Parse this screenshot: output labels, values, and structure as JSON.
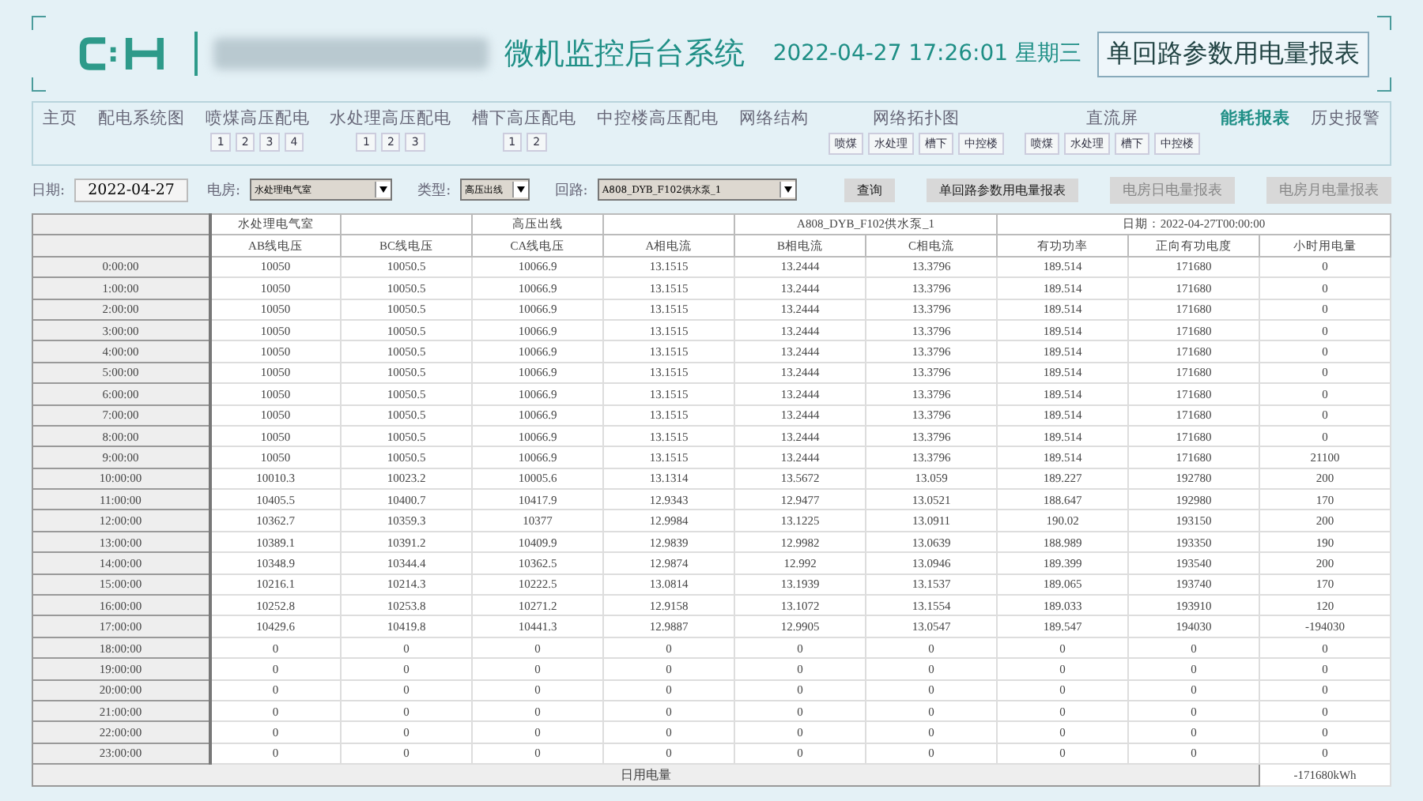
{
  "header": {
    "system_title": "微机监控后台系统",
    "datetime": "2022-04-27 17:26:01 星期三",
    "report_title": "单回路参数用电量报表"
  },
  "nav": [
    {
      "label": "主页",
      "selected": false
    },
    {
      "label": "配电系统图",
      "selected": false
    },
    {
      "label": "喷煤高压配电",
      "selected": false,
      "subs": [
        "1",
        "2",
        "3",
        "4"
      ]
    },
    {
      "label": "水处理高压配电",
      "selected": false,
      "subs": [
        "1",
        "2",
        "3"
      ]
    },
    {
      "label": "槽下高压配电",
      "selected": false,
      "subs": [
        "1",
        "2"
      ]
    },
    {
      "label": "中控楼高压配电",
      "selected": false
    },
    {
      "label": "网络结构",
      "selected": false
    },
    {
      "label": "网络拓扑图",
      "selected": false,
      "subs": [
        "喷煤",
        "水处理",
        "槽下",
        "中控楼"
      ]
    },
    {
      "label": "直流屏",
      "selected": false,
      "subs": [
        "喷煤",
        "水处理",
        "槽下",
        "中控楼"
      ]
    },
    {
      "label": "能耗报表",
      "selected": true
    },
    {
      "label": "历史报警",
      "selected": false
    }
  ],
  "toolbar": {
    "date_label": "日期:",
    "date": "2022-04-27",
    "room_label": "电房:",
    "room": "水处理电气室",
    "type_label": "类型:",
    "type": "高压出线",
    "circuit_label": "回路:",
    "circuit": "A808_DYB_F102供水泵_1",
    "buttons": [
      {
        "label": "查询",
        "disabled": false
      },
      {
        "label": "单回路参数用电量报表",
        "disabled": false
      },
      {
        "label": "电房日电量报表",
        "disabled": true
      },
      {
        "label": "电房月电量报表",
        "disabled": true
      }
    ]
  },
  "table": {
    "group_headers": {
      "room": "水处理电气室",
      "type": "高压出线",
      "circuit": "A808_DYB_F102供水泵_1",
      "date": "日期：2022-04-27T00:00:00"
    },
    "columns": [
      "",
      "AB线电压",
      "BC线电压",
      "CA线电压",
      "A相电流",
      "B相电流",
      "C相电流",
      "有功功率",
      "正向有功电度",
      "小时用电量"
    ],
    "rows": [
      [
        "0:00:00",
        "10050",
        "10050.5",
        "10066.9",
        "13.1515",
        "13.2444",
        "13.3796",
        "189.514",
        "171680",
        "0"
      ],
      [
        "1:00:00",
        "10050",
        "10050.5",
        "10066.9",
        "13.1515",
        "13.2444",
        "13.3796",
        "189.514",
        "171680",
        "0"
      ],
      [
        "2:00:00",
        "10050",
        "10050.5",
        "10066.9",
        "13.1515",
        "13.2444",
        "13.3796",
        "189.514",
        "171680",
        "0"
      ],
      [
        "3:00:00",
        "10050",
        "10050.5",
        "10066.9",
        "13.1515",
        "13.2444",
        "13.3796",
        "189.514",
        "171680",
        "0"
      ],
      [
        "4:00:00",
        "10050",
        "10050.5",
        "10066.9",
        "13.1515",
        "13.2444",
        "13.3796",
        "189.514",
        "171680",
        "0"
      ],
      [
        "5:00:00",
        "10050",
        "10050.5",
        "10066.9",
        "13.1515",
        "13.2444",
        "13.3796",
        "189.514",
        "171680",
        "0"
      ],
      [
        "6:00:00",
        "10050",
        "10050.5",
        "10066.9",
        "13.1515",
        "13.2444",
        "13.3796",
        "189.514",
        "171680",
        "0"
      ],
      [
        "7:00:00",
        "10050",
        "10050.5",
        "10066.9",
        "13.1515",
        "13.2444",
        "13.3796",
        "189.514",
        "171680",
        "0"
      ],
      [
        "8:00:00",
        "10050",
        "10050.5",
        "10066.9",
        "13.1515",
        "13.2444",
        "13.3796",
        "189.514",
        "171680",
        "0"
      ],
      [
        "9:00:00",
        "10050",
        "10050.5",
        "10066.9",
        "13.1515",
        "13.2444",
        "13.3796",
        "189.514",
        "171680",
        "21100"
      ],
      [
        "10:00:00",
        "10010.3",
        "10023.2",
        "10005.6",
        "13.1314",
        "13.5672",
        "13.059",
        "189.227",
        "192780",
        "200"
      ],
      [
        "11:00:00",
        "10405.5",
        "10400.7",
        "10417.9",
        "12.9343",
        "12.9477",
        "13.0521",
        "188.647",
        "192980",
        "170"
      ],
      [
        "12:00:00",
        "10362.7",
        "10359.3",
        "10377",
        "12.9984",
        "13.1225",
        "13.0911",
        "190.02",
        "193150",
        "200"
      ],
      [
        "13:00:00",
        "10389.1",
        "10391.2",
        "10409.9",
        "12.9839",
        "12.9982",
        "13.0639",
        "188.989",
        "193350",
        "190"
      ],
      [
        "14:00:00",
        "10348.9",
        "10344.4",
        "10362.5",
        "12.9874",
        "12.992",
        "13.0946",
        "189.399",
        "193540",
        "200"
      ],
      [
        "15:00:00",
        "10216.1",
        "10214.3",
        "10222.5",
        "13.0814",
        "13.1939",
        "13.1537",
        "189.065",
        "193740",
        "170"
      ],
      [
        "16:00:00",
        "10252.8",
        "10253.8",
        "10271.2",
        "12.9158",
        "13.1072",
        "13.1554",
        "189.033",
        "193910",
        "120"
      ],
      [
        "17:00:00",
        "10429.6",
        "10419.8",
        "10441.3",
        "12.9887",
        "12.9905",
        "13.0547",
        "189.547",
        "194030",
        "-194030"
      ],
      [
        "18:00:00",
        "0",
        "0",
        "0",
        "0",
        "0",
        "0",
        "0",
        "0",
        "0"
      ],
      [
        "19:00:00",
        "0",
        "0",
        "0",
        "0",
        "0",
        "0",
        "0",
        "0",
        "0"
      ],
      [
        "20:00:00",
        "0",
        "0",
        "0",
        "0",
        "0",
        "0",
        "0",
        "0",
        "0"
      ],
      [
        "21:00:00",
        "0",
        "0",
        "0",
        "0",
        "0",
        "0",
        "0",
        "0",
        "0"
      ],
      [
        "22:00:00",
        "0",
        "0",
        "0",
        "0",
        "0",
        "0",
        "0",
        "0",
        "0"
      ],
      [
        "23:00:00",
        "0",
        "0",
        "0",
        "0",
        "0",
        "0",
        "0",
        "0",
        "0"
      ]
    ],
    "footer_label": "日用电量",
    "footer_value": "-171680kWh"
  }
}
